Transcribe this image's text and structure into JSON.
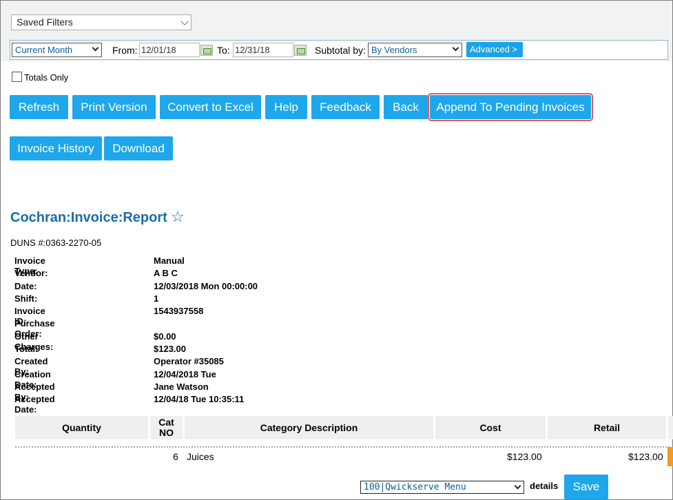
{
  "filters": {
    "saved_filters": "Saved Filters",
    "period": "Current Month",
    "from_label": "From:",
    "from_value": "12/01/18",
    "to_label": "To:",
    "to_value": "12/31/18",
    "subtotal_label": "Subtotal by:",
    "subtotal_value": "By Vendors",
    "advanced": "Advanced >",
    "totals_only": "Totals Only"
  },
  "buttons": {
    "refresh": "Refresh",
    "print": "Print Version",
    "excel": "Convert to Excel",
    "help": "Help",
    "feedback": "Feedback",
    "back": "Back",
    "append": "Append To Pending Invoices",
    "history": "Invoice History",
    "download": "Download",
    "save": "Save"
  },
  "report": {
    "title": "Cochran:Invoice:Report",
    "duns": "DUNS #:0363-2270-05",
    "fields": [
      {
        "label": "Invoice Type:",
        "value": "Manual"
      },
      {
        "label": "Vendor:",
        "value": "A B C"
      },
      {
        "label": "Date:",
        "value": "12/03/2018 Mon 00:00:00"
      },
      {
        "label": "Shift:",
        "value": "1"
      },
      {
        "label": "Invoice ID:",
        "value": "1543937558"
      },
      {
        "label": "Purchase Order:",
        "value": ""
      },
      {
        "label": "Other Charges:",
        "value": "$0.00"
      },
      {
        "label": "Total:",
        "value": "$123.00"
      },
      {
        "label": "Created By:",
        "value": "Operator #35085"
      },
      {
        "label": "Creation Date:",
        "value": "12/04/2018 Tue"
      },
      {
        "label": "Accepted By:",
        "value": "Jane Watson"
      },
      {
        "label": "Accepted Date:",
        "value": "12/04/18 Tue 10:35:11"
      }
    ]
  },
  "table": {
    "headers": {
      "quantity": "Quantity",
      "cat_no": "Cat NO",
      "description": "Category Description",
      "cost": "Cost",
      "retail": "Retail"
    },
    "row": {
      "quantity": "6",
      "description": "Juices",
      "cost": "$123.00",
      "retail": "$123.00"
    }
  },
  "footer": {
    "menu": "100|Qwickserve Menu",
    "details": "details"
  }
}
